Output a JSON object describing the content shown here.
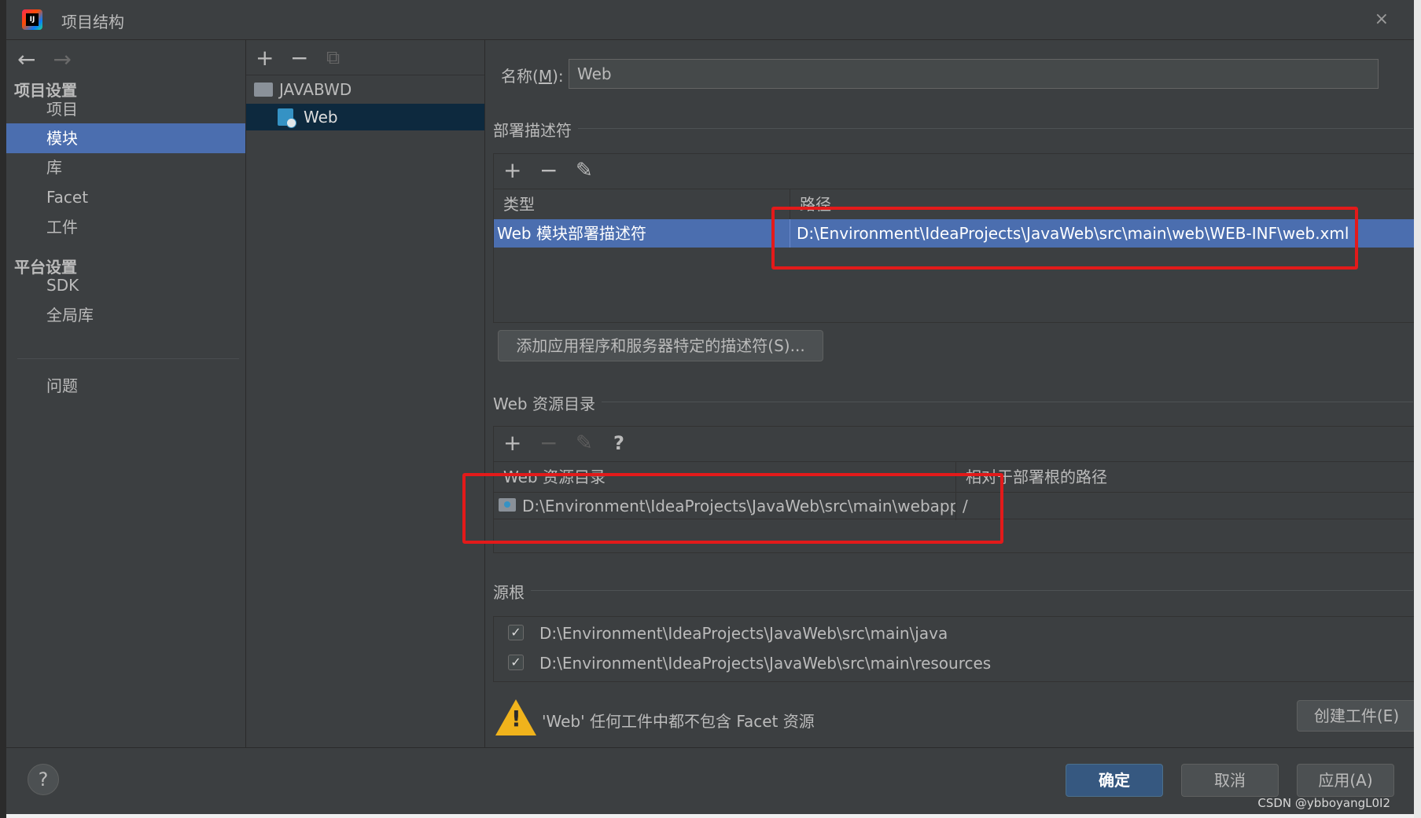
{
  "window": {
    "title": "项目结构",
    "close_glyph": "×"
  },
  "nav": {
    "back_glyph": "←",
    "forward_glyph": "→",
    "project_settings_header": "项目设置",
    "platform_settings_header": "平台设置",
    "items": [
      {
        "label": "项目",
        "selected": false
      },
      {
        "label": "模块",
        "selected": true
      },
      {
        "label": "库",
        "selected": false
      },
      {
        "label": "Facet",
        "selected": false
      },
      {
        "label": "工件",
        "selected": false
      }
    ],
    "platform_items": [
      {
        "label": "SDK"
      },
      {
        "label": "全局库"
      }
    ],
    "problems": "问题"
  },
  "tree": {
    "toolbar": {
      "add": "+",
      "remove": "−",
      "copy": "⧉"
    },
    "nodes": [
      {
        "label": "JAVABWD",
        "icon": "folder-module-icon",
        "selected": false
      },
      {
        "label": "Web",
        "icon": "web-facet-icon",
        "selected": true
      }
    ]
  },
  "main": {
    "name_label_prefix": "名称(",
    "name_label_mnemonic": "M",
    "name_label_suffix": "):",
    "name_value": "Web",
    "deploy": {
      "title": "部署描述符",
      "toolbar": {
        "add": "+",
        "remove": "−",
        "edit": "✎"
      },
      "columns": [
        "类型",
        "路径"
      ],
      "rows": [
        {
          "type": "Web 模块部署描述符",
          "path": "D:\\Environment\\IdeaProjects\\JavaWeb\\src\\main\\web\\WEB-INF\\web.xml"
        }
      ],
      "add_server_button": "添加应用程序和服务器特定的描述符(S)..."
    },
    "webres": {
      "title": "Web 资源目录",
      "toolbar": {
        "add": "+",
        "remove": "−",
        "edit": "✎",
        "help": "?"
      },
      "columns": [
        "Web 资源目录",
        "相对于部署根的路径"
      ],
      "rows": [
        {
          "dir": "D:\\Environment\\IdeaProjects\\JavaWeb\\src\\main\\webapp",
          "relative": "/"
        }
      ]
    },
    "sources": {
      "title": "源根",
      "items": [
        {
          "path": "D:\\Environment\\IdeaProjects\\JavaWeb\\src\\main\\java",
          "checked": true
        },
        {
          "path": "D:\\Environment\\IdeaProjects\\JavaWeb\\src\\main\\resources",
          "checked": true
        }
      ]
    },
    "warning_text": "'Web' 任何工件中都不包含 Facet 资源",
    "create_artifact_button": "创建工件(E)"
  },
  "footer": {
    "help": "?",
    "ok": "确定",
    "cancel": "取消",
    "apply": "应用(A)"
  },
  "watermark": "CSDN @ybboyangL0I2",
  "colors": {
    "background": "#3c3f41",
    "selection": "#4b6eaf",
    "primary_button": "#365880",
    "annotation_red": "#e31a1a",
    "warning": "#f0b31c"
  }
}
